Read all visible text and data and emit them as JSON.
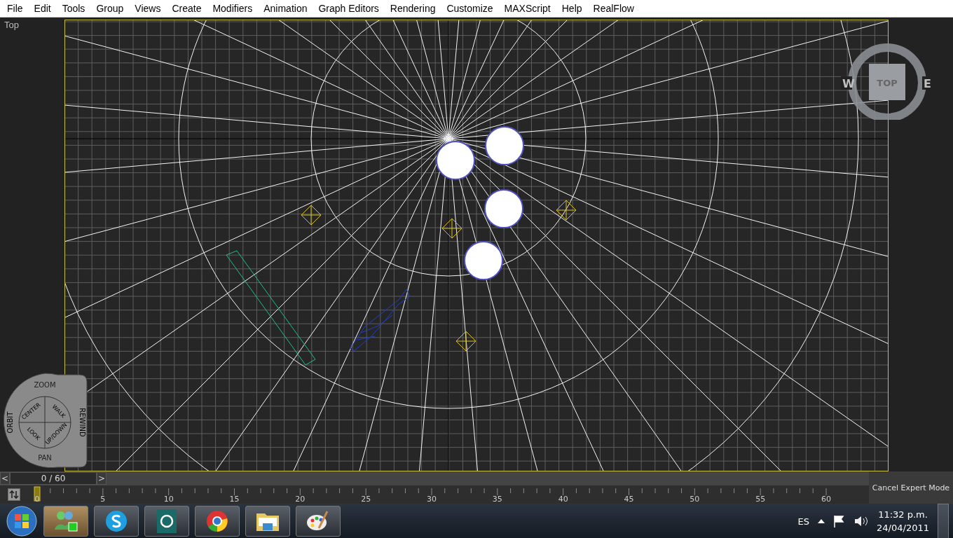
{
  "menu": [
    "File",
    "Edit",
    "Tools",
    "Group",
    "Views",
    "Create",
    "Modifiers",
    "Animation",
    "Graph Editors",
    "Rendering",
    "Customize",
    "MAXScript",
    "Help",
    "RealFlow"
  ],
  "viewport": {
    "label": "Top",
    "viewcube": {
      "face": "TOP",
      "west": "W",
      "east": "E"
    },
    "steering_wheel": {
      "outer": [
        "ZOOM",
        "ORBIT",
        "REWIND",
        "PAN"
      ],
      "inner": [
        "CENTER",
        "WALK",
        "LOOK",
        "UP/DOWN"
      ]
    }
  },
  "time_slider": {
    "prev": "<",
    "frame": "0 / 60",
    "next": ">",
    "level": 0
  },
  "track_bar": {
    "ticks": [
      "0",
      "5",
      "10",
      "15",
      "20",
      "25",
      "30",
      "35",
      "40",
      "45",
      "50",
      "55",
      "60"
    ],
    "status": "Cancel Expert Mode"
  },
  "taskbar": {
    "language": "ES",
    "time": "11:32 p.m.",
    "date": "24/04/2011"
  }
}
